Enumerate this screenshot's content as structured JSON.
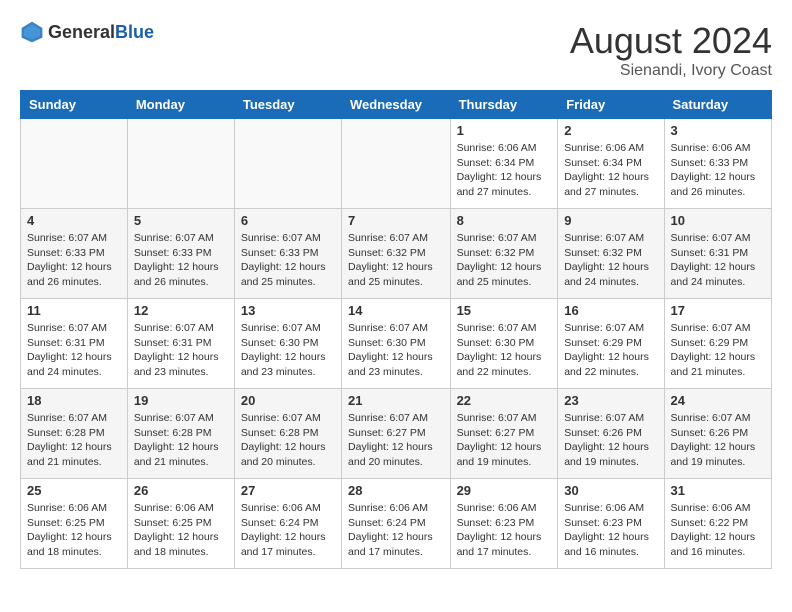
{
  "header": {
    "logo_general": "General",
    "logo_blue": "Blue",
    "month_title": "August 2024",
    "location": "Sienandi, Ivory Coast"
  },
  "days_of_week": [
    "Sunday",
    "Monday",
    "Tuesday",
    "Wednesday",
    "Thursday",
    "Friday",
    "Saturday"
  ],
  "weeks": [
    [
      {
        "day": "",
        "info": ""
      },
      {
        "day": "",
        "info": ""
      },
      {
        "day": "",
        "info": ""
      },
      {
        "day": "",
        "info": ""
      },
      {
        "day": "1",
        "info": "Sunrise: 6:06 AM\nSunset: 6:34 PM\nDaylight: 12 hours and 27 minutes."
      },
      {
        "day": "2",
        "info": "Sunrise: 6:06 AM\nSunset: 6:34 PM\nDaylight: 12 hours and 27 minutes."
      },
      {
        "day": "3",
        "info": "Sunrise: 6:06 AM\nSunset: 6:33 PM\nDaylight: 12 hours and 26 minutes."
      }
    ],
    [
      {
        "day": "4",
        "info": "Sunrise: 6:07 AM\nSunset: 6:33 PM\nDaylight: 12 hours and 26 minutes."
      },
      {
        "day": "5",
        "info": "Sunrise: 6:07 AM\nSunset: 6:33 PM\nDaylight: 12 hours and 26 minutes."
      },
      {
        "day": "6",
        "info": "Sunrise: 6:07 AM\nSunset: 6:33 PM\nDaylight: 12 hours and 25 minutes."
      },
      {
        "day": "7",
        "info": "Sunrise: 6:07 AM\nSunset: 6:32 PM\nDaylight: 12 hours and 25 minutes."
      },
      {
        "day": "8",
        "info": "Sunrise: 6:07 AM\nSunset: 6:32 PM\nDaylight: 12 hours and 25 minutes."
      },
      {
        "day": "9",
        "info": "Sunrise: 6:07 AM\nSunset: 6:32 PM\nDaylight: 12 hours and 24 minutes."
      },
      {
        "day": "10",
        "info": "Sunrise: 6:07 AM\nSunset: 6:31 PM\nDaylight: 12 hours and 24 minutes."
      }
    ],
    [
      {
        "day": "11",
        "info": "Sunrise: 6:07 AM\nSunset: 6:31 PM\nDaylight: 12 hours and 24 minutes."
      },
      {
        "day": "12",
        "info": "Sunrise: 6:07 AM\nSunset: 6:31 PM\nDaylight: 12 hours and 23 minutes."
      },
      {
        "day": "13",
        "info": "Sunrise: 6:07 AM\nSunset: 6:30 PM\nDaylight: 12 hours and 23 minutes."
      },
      {
        "day": "14",
        "info": "Sunrise: 6:07 AM\nSunset: 6:30 PM\nDaylight: 12 hours and 23 minutes."
      },
      {
        "day": "15",
        "info": "Sunrise: 6:07 AM\nSunset: 6:30 PM\nDaylight: 12 hours and 22 minutes."
      },
      {
        "day": "16",
        "info": "Sunrise: 6:07 AM\nSunset: 6:29 PM\nDaylight: 12 hours and 22 minutes."
      },
      {
        "day": "17",
        "info": "Sunrise: 6:07 AM\nSunset: 6:29 PM\nDaylight: 12 hours and 21 minutes."
      }
    ],
    [
      {
        "day": "18",
        "info": "Sunrise: 6:07 AM\nSunset: 6:28 PM\nDaylight: 12 hours and 21 minutes."
      },
      {
        "day": "19",
        "info": "Sunrise: 6:07 AM\nSunset: 6:28 PM\nDaylight: 12 hours and 21 minutes."
      },
      {
        "day": "20",
        "info": "Sunrise: 6:07 AM\nSunset: 6:28 PM\nDaylight: 12 hours and 20 minutes."
      },
      {
        "day": "21",
        "info": "Sunrise: 6:07 AM\nSunset: 6:27 PM\nDaylight: 12 hours and 20 minutes."
      },
      {
        "day": "22",
        "info": "Sunrise: 6:07 AM\nSunset: 6:27 PM\nDaylight: 12 hours and 19 minutes."
      },
      {
        "day": "23",
        "info": "Sunrise: 6:07 AM\nSunset: 6:26 PM\nDaylight: 12 hours and 19 minutes."
      },
      {
        "day": "24",
        "info": "Sunrise: 6:07 AM\nSunset: 6:26 PM\nDaylight: 12 hours and 19 minutes."
      }
    ],
    [
      {
        "day": "25",
        "info": "Sunrise: 6:06 AM\nSunset: 6:25 PM\nDaylight: 12 hours and 18 minutes."
      },
      {
        "day": "26",
        "info": "Sunrise: 6:06 AM\nSunset: 6:25 PM\nDaylight: 12 hours and 18 minutes."
      },
      {
        "day": "27",
        "info": "Sunrise: 6:06 AM\nSunset: 6:24 PM\nDaylight: 12 hours and 17 minutes."
      },
      {
        "day": "28",
        "info": "Sunrise: 6:06 AM\nSunset: 6:24 PM\nDaylight: 12 hours and 17 minutes."
      },
      {
        "day": "29",
        "info": "Sunrise: 6:06 AM\nSunset: 6:23 PM\nDaylight: 12 hours and 17 minutes."
      },
      {
        "day": "30",
        "info": "Sunrise: 6:06 AM\nSunset: 6:23 PM\nDaylight: 12 hours and 16 minutes."
      },
      {
        "day": "31",
        "info": "Sunrise: 6:06 AM\nSunset: 6:22 PM\nDaylight: 12 hours and 16 minutes."
      }
    ]
  ]
}
